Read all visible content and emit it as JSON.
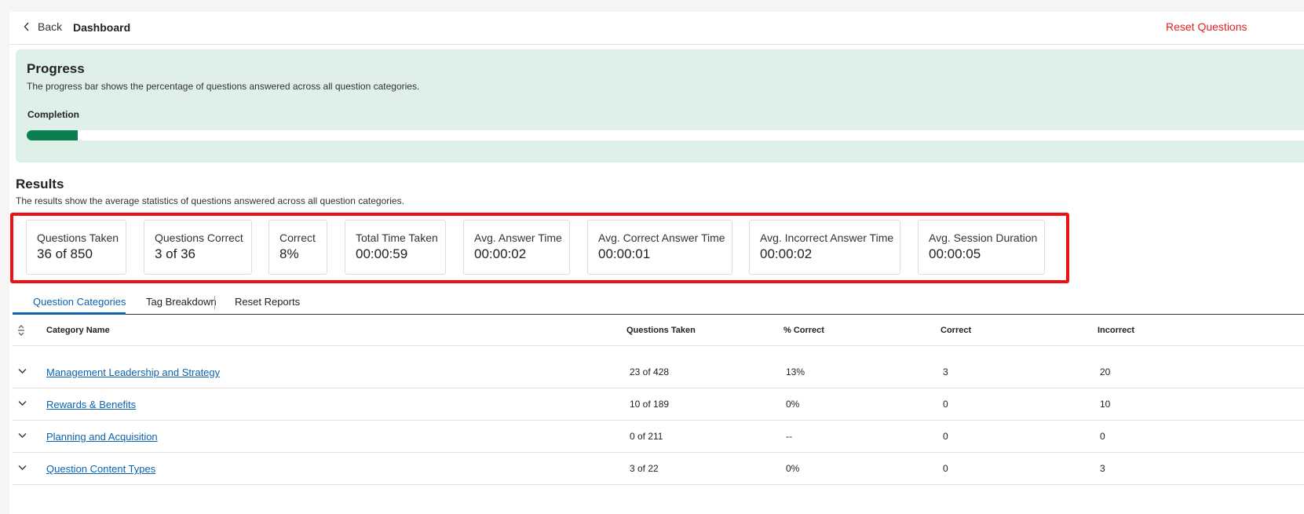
{
  "header": {
    "back_label": "Back",
    "breadcrumb": "Dashboard",
    "reset_label": "Reset Questions"
  },
  "progress": {
    "title": "Progress",
    "description": "The progress bar shows the percentage of questions answered across all question categories.",
    "completion_label": "Completion",
    "completion_fraction": 0.04
  },
  "results": {
    "title": "Results",
    "description": "The results show the average statistics of questions answered across all question categories.",
    "stats": [
      {
        "label": "Questions Taken",
        "value": "36 of 850"
      },
      {
        "label": "Questions Correct",
        "value": "3 of 36"
      },
      {
        "label": "Correct",
        "value": "8%"
      },
      {
        "label": "Total Time Taken",
        "value": "00:00:59"
      },
      {
        "label": "Avg. Answer Time",
        "value": "00:00:02"
      },
      {
        "label": "Avg. Correct Answer Time",
        "value": "00:00:01"
      },
      {
        "label": "Avg. Incorrect Answer Time",
        "value": "00:00:02"
      },
      {
        "label": "Avg. Session Duration",
        "value": "00:00:05"
      }
    ]
  },
  "tabs": [
    "Question Categories",
    "Tag Breakdown",
    "Reset Reports"
  ],
  "table": {
    "headers": [
      "Category Name",
      "Questions Taken",
      "% Correct",
      "Correct",
      "Incorrect"
    ],
    "rows": [
      {
        "name": "Management Leadership and Strategy",
        "taken": "23 of 428",
        "pct": "13%",
        "correct": "3",
        "incorrect": "20"
      },
      {
        "name": "Rewards & Benefits",
        "taken": "10 of 189",
        "pct": "0%",
        "correct": "0",
        "incorrect": "10"
      },
      {
        "name": "Planning and Acquisition",
        "taken": "0 of 211",
        "pct": "--",
        "correct": "0",
        "incorrect": "0"
      },
      {
        "name": "Question Content Types",
        "taken": "3 of 22",
        "pct": "0%",
        "correct": "0",
        "incorrect": "3"
      }
    ]
  },
  "colors": {
    "accent": "#0a62b0",
    "progress_fill": "#0b7f50",
    "progress_bg": "#dff0e8",
    "danger": "#dd2222",
    "highlight": "#ee1111"
  },
  "icons": {
    "back": "chevron-left-icon",
    "sort": "sort-icon",
    "expand": "chevron-down-icon"
  }
}
